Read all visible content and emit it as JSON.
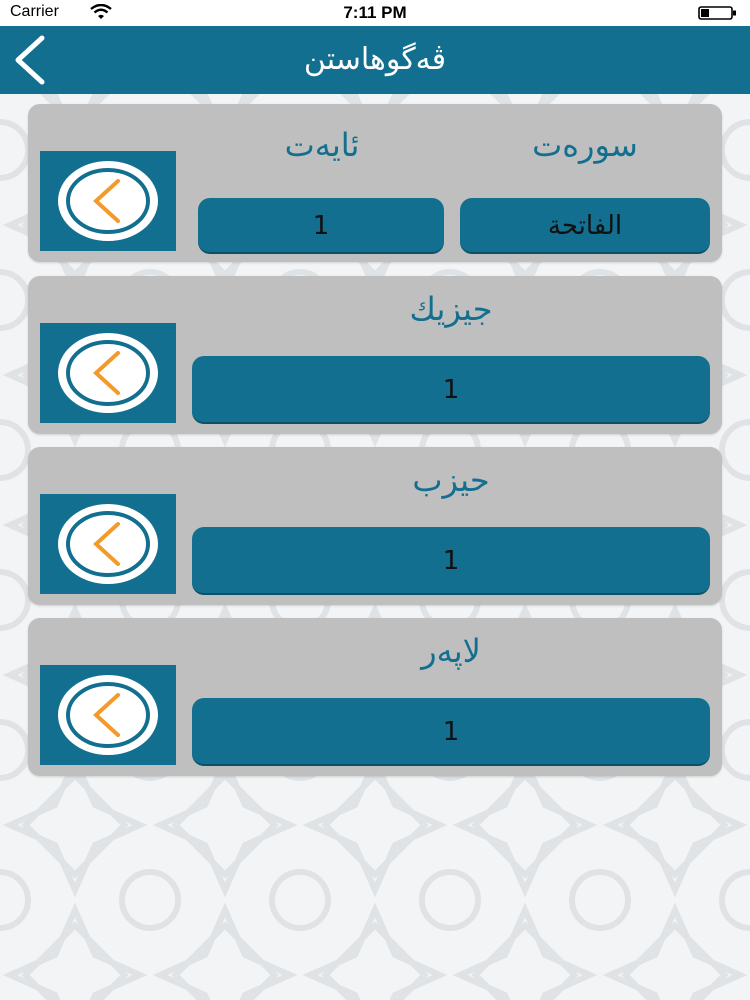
{
  "status_bar": {
    "carrier": "Carrier",
    "time": "7:11 PM",
    "icons": [
      "wifi-icon",
      "battery-icon"
    ]
  },
  "nav": {
    "title": "ڤەگوهاستن",
    "back_icon": "chevron-left-icon"
  },
  "colors": {
    "primary": "#126f8f",
    "card": "#bfbfbf",
    "accent": "#f39a2b",
    "background": "#f3f4f5"
  },
  "cards": {
    "surah_ayah": {
      "surah_label": "سورەت",
      "ayah_label": "ئایەت",
      "surah_value": "الفاتحة",
      "ayah_value": "1"
    },
    "juz": {
      "label": "جیزیك",
      "value": "1"
    },
    "hizb": {
      "label": "حیزب",
      "value": "1"
    },
    "page": {
      "label": "لاپەر",
      "value": "1"
    }
  }
}
